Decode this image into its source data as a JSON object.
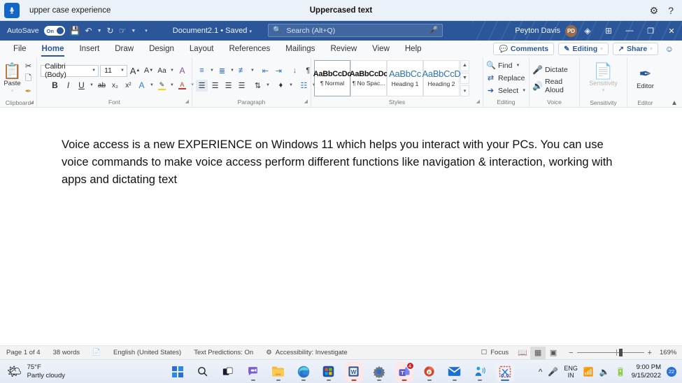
{
  "voice_access": {
    "mic_icon": "microphone-icon",
    "status_text": "upper case experience",
    "title": "Uppercased text",
    "settings_icon": "gear-icon",
    "help_icon": "question-mark-icon"
  },
  "title_bar": {
    "autosave_label": "AutoSave",
    "autosave_state": "On",
    "save_icon": "save-icon",
    "undo_icon": "undo-icon",
    "redo_icon": "redo-icon",
    "touch_icon": "touch-mode-icon",
    "customize_icon": "customize-quick-access-icon",
    "document_name": "Document2.1 • Saved",
    "search_placeholder": "Search (Alt+Q)",
    "search_icon": "search-icon",
    "search_mic_icon": "microphone-icon",
    "user_name": "Peyton Davis",
    "avatar_initials": "PD",
    "diamond_icon": "diamond-icon",
    "ribbon_display_icon": "ribbon-display-options-icon",
    "minimize_label": "—",
    "restore_label": "❐",
    "close_label": "✕",
    "accent_color": "#2b579a"
  },
  "ribbon": {
    "tabs": [
      {
        "label": "File",
        "active": false
      },
      {
        "label": "Home",
        "active": true
      },
      {
        "label": "Insert",
        "active": false
      },
      {
        "label": "Draw",
        "active": false
      },
      {
        "label": "Design",
        "active": false
      },
      {
        "label": "Layout",
        "active": false
      },
      {
        "label": "References",
        "active": false
      },
      {
        "label": "Mailings",
        "active": false
      },
      {
        "label": "Review",
        "active": false
      },
      {
        "label": "View",
        "active": false
      },
      {
        "label": "Help",
        "active": false
      }
    ],
    "comments_label": "Comments",
    "editing_label": "Editing",
    "share_label": "Share",
    "present_icon": "present-icon",
    "collapse_icon": "collapse-ribbon-icon",
    "groups": {
      "clipboard": {
        "label": "Clipboard",
        "paste_label": "Paste",
        "cut_icon": "scissors-icon",
        "copy_icon": "copy-icon",
        "format_painter_icon": "format-painter-icon"
      },
      "font": {
        "label": "Font",
        "font_family": "Calibri (Body)",
        "font_size": "11",
        "grow_font": "A",
        "shrink_font": "A",
        "change_case": "Aa",
        "clear_formatting": "A",
        "bold": "B",
        "italic": "I",
        "underline": "U",
        "strikethrough": "ab",
        "subscript": "x₂",
        "superscript": "x²",
        "text_effects": "A",
        "highlight": "A",
        "font_color": "A"
      },
      "paragraph": {
        "label": "Paragraph",
        "bullets_icon": "bullet-list-icon",
        "numbering_icon": "numbered-list-icon",
        "multilevel_icon": "multilevel-list-icon",
        "decrease_indent_icon": "decrease-indent-icon",
        "increase_indent_icon": "increase-indent-icon",
        "sort_icon": "sort-icon",
        "show_marks_icon": "paragraph-marks-icon",
        "align_left_icon": "align-left-icon",
        "align_center_icon": "align-center-icon",
        "align_right_icon": "align-right-icon",
        "justify_icon": "justify-icon",
        "line_spacing_icon": "line-spacing-icon",
        "shading_icon": "shading-icon",
        "borders_icon": "borders-icon"
      },
      "styles": {
        "label": "Styles",
        "items": [
          {
            "preview": "AaBbCcDc",
            "name": "¶ Normal",
            "selected": true,
            "blue": false
          },
          {
            "preview": "AaBbCcDc",
            "name": "¶ No Spac...",
            "selected": false,
            "blue": false
          },
          {
            "preview": "AaBbCc",
            "name": "Heading 1",
            "selected": false,
            "blue": true
          },
          {
            "preview": "AaBbCcD",
            "name": "Heading 2",
            "selected": false,
            "blue": true
          }
        ]
      },
      "editing": {
        "label": "Editing",
        "find_label": "Find",
        "replace_label": "Replace",
        "select_label": "Select"
      },
      "voice": {
        "label": "Voice",
        "dictate_label": "Dictate",
        "read_aloud_label": "Read Aloud"
      },
      "sensitivity": {
        "label": "Sensitivity",
        "button_label": "Sensitivity"
      },
      "editor": {
        "label": "Editor",
        "button_label": "Editor"
      }
    }
  },
  "document": {
    "body_text": "Voice access is a new EXPERIENCE on Windows 11 which helps you interact with your PCs. You can use voice commands to make voice access perform different functions like navigation & interaction, working with apps and dictating text"
  },
  "status_bar": {
    "page": "Page 1 of 4",
    "words": "38 words",
    "proofing_icon": "proofing-errors-icon",
    "language": "English (United States)",
    "text_predictions": "Text Predictions: On",
    "accessibility": "Accessibility: Investigate",
    "focus_label": "Focus",
    "read_mode_icon": "read-mode-icon",
    "print_layout_icon": "print-layout-icon",
    "web_layout_icon": "web-layout-icon",
    "zoom_out": "−",
    "zoom_in": "+",
    "zoom_level": "169%"
  },
  "taskbar": {
    "weather_temp": "75°F",
    "weather_desc": "Partly cloudy",
    "weather_icon": "partly-cloudy-icon",
    "apps": [
      {
        "name": "start-button",
        "icon": "windows-logo-icon"
      },
      {
        "name": "search-button",
        "icon": "search-icon"
      },
      {
        "name": "task-view-button",
        "icon": "task-view-icon"
      },
      {
        "name": "chat-button",
        "icon": "chat-icon"
      },
      {
        "name": "file-explorer",
        "icon": "folder-icon"
      },
      {
        "name": "microsoft-edge",
        "icon": "edge-icon"
      },
      {
        "name": "microsoft-store",
        "icon": "store-icon"
      },
      {
        "name": "microsoft-word",
        "icon": "word-icon"
      },
      {
        "name": "settings",
        "icon": "gear-icon"
      },
      {
        "name": "microsoft-teams",
        "icon": "teams-icon",
        "badge": "4"
      },
      {
        "name": "powerpoint",
        "icon": "powerpoint-icon"
      },
      {
        "name": "mail",
        "icon": "mail-icon"
      },
      {
        "name": "accessibility-app",
        "icon": "voice-access-icon"
      },
      {
        "name": "snipping-tool",
        "icon": "snipping-tool-icon"
      }
    ],
    "tray": {
      "overflow_icon": "chevron-up-icon",
      "mic_icon": "microphone-icon",
      "language_line1": "ENG",
      "language_line2": "IN",
      "wifi_icon": "wifi-icon",
      "volume_icon": "speaker-icon",
      "battery_icon": "battery-icon",
      "time": "9:00 PM",
      "date": "9/15/2022",
      "notification_count": "22"
    }
  }
}
